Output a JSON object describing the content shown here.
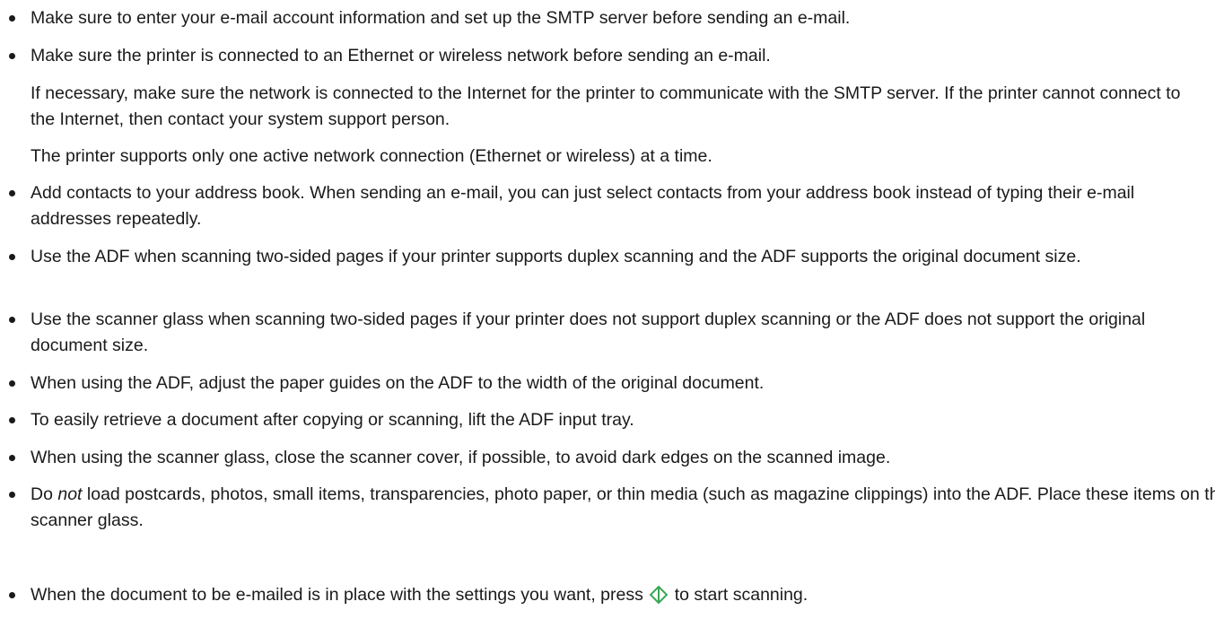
{
  "tips": [
    {
      "type": "bullet",
      "text": "Make sure to enter your e-mail account information and set up the SMTP server before sending an e-mail."
    },
    {
      "type": "bullet",
      "text": "Make sure the printer is connected to an Ethernet or wireless network before sending an e-mail."
    },
    {
      "type": "note",
      "text": "If necessary, make sure the network is connected to the Internet for the printer to communicate with the SMTP server. If the printer cannot connect to the Internet, then contact your system support person."
    },
    {
      "type": "note",
      "text": "The printer supports only one active network connection (Ethernet or wireless) at a time."
    },
    {
      "type": "bullet",
      "text": "Add contacts to your address book. When sending an e-mail, you can just select contacts from your address book instead of typing their e-mail addresses repeatedly."
    },
    {
      "type": "bullet",
      "text": "Use the ADF when scanning two-sided pages if your printer supports duplex scanning and the ADF supports the original document size."
    },
    {
      "type": "bullet",
      "text": "Use the scanner glass when scanning two-sided pages if your printer does not support duplex scanning or the ADF does not support the original document size."
    },
    {
      "type": "bullet",
      "text": "When using the ADF, adjust the paper guides on the ADF to the width of the original document."
    },
    {
      "type": "bullet",
      "text": "To easily retrieve a document after copying or scanning, lift the ADF input tray."
    },
    {
      "type": "bullet",
      "text": "When using the scanner glass, close the scanner cover, if possible, to avoid dark edges on the scanned image."
    },
    {
      "type": "bullet-emph",
      "emph": "not",
      "before": "Do ",
      "after": " load postcards, photos, small items, transparencies, photo paper, or thin media (such as magazine clippings) into the ADF. Place these items on the scanner glass."
    },
    {
      "type": "bullet-icon",
      "before": "When the document to be e-mailed is in place with the settings you want, press ",
      "icon": "start-button-icon",
      "after": " to start scanning."
    }
  ],
  "colors": {
    "text": "#1a1a1a",
    "start_icon": "#3aa655"
  }
}
